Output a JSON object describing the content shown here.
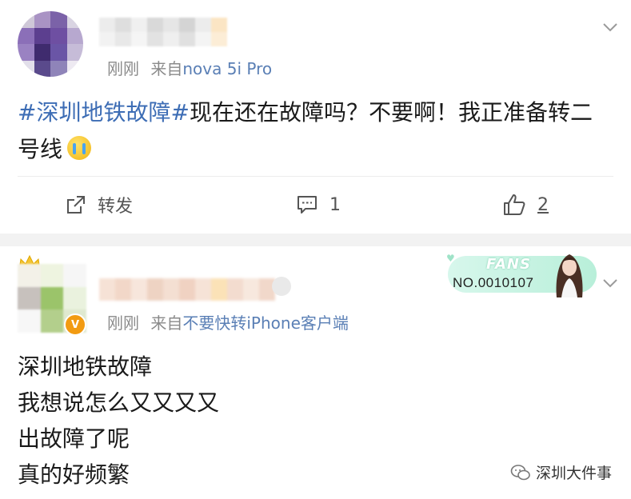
{
  "post1": {
    "time": "刚刚",
    "source_prefix": "来自",
    "source": "nova 5i Pro",
    "hashtag": "#深圳地铁故障#",
    "text": "现在还在故障吗？不要啊！我正准备转二号线",
    "actions": {
      "repost_label": "转发",
      "comment_count": "1",
      "like_count": "2"
    }
  },
  "post2": {
    "time": "刚刚",
    "source_prefix": "来自",
    "source": "不要快转iPhone客户端",
    "fans_badge": {
      "word": "FANS",
      "number": "NO.0010107"
    },
    "lines": [
      "深圳地铁故障",
      "我想说怎么又又又又",
      "出故障了呢",
      "真的好频繁"
    ]
  },
  "watermark": "深圳大件事",
  "colors": {
    "link": "#3d6db5",
    "meta": "#8a8a8a",
    "fans_pill": "#c4f2e0"
  }
}
